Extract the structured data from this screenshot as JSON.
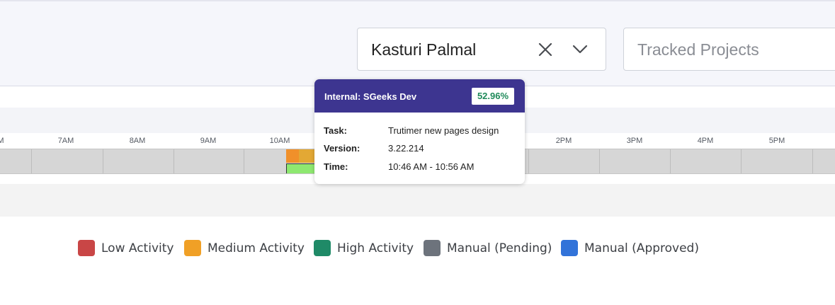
{
  "filters": {
    "user_select": {
      "value": "Kasturi Palmal",
      "clear_icon": "close-icon",
      "dropdown_icon": "chevron-down-icon"
    },
    "projects": {
      "placeholder": "Tracked Projects"
    }
  },
  "timeline": {
    "hours": [
      "M",
      "7AM",
      "8AM",
      "9AM",
      "10AM",
      "2PM",
      "3PM",
      "4PM",
      "5PM"
    ]
  },
  "tooltip": {
    "title": "Internal: SGeeks Dev",
    "percentage": "52.96%",
    "rows": [
      {
        "label": "Task:",
        "value": "Trutimer new pages design"
      },
      {
        "label": "Version:",
        "value": "3.22.214"
      },
      {
        "label": "Time:",
        "value": "10:46 AM - 10:56 AM"
      }
    ]
  },
  "legend": [
    {
      "label": "Low Activity",
      "color": "#c94646"
    },
    {
      "label": "Medium Activity",
      "color": "#f0a026"
    },
    {
      "label": "High Activity",
      "color": "#1f8a67"
    },
    {
      "label": "Manual (Pending)",
      "color": "#6d737c"
    },
    {
      "label": "Manual (Approved)",
      "color": "#3273d9"
    }
  ],
  "colors": {
    "tooltip_header": "#3d3590",
    "segment_medium": "#f0902a",
    "segment_high": "#8ee870"
  }
}
